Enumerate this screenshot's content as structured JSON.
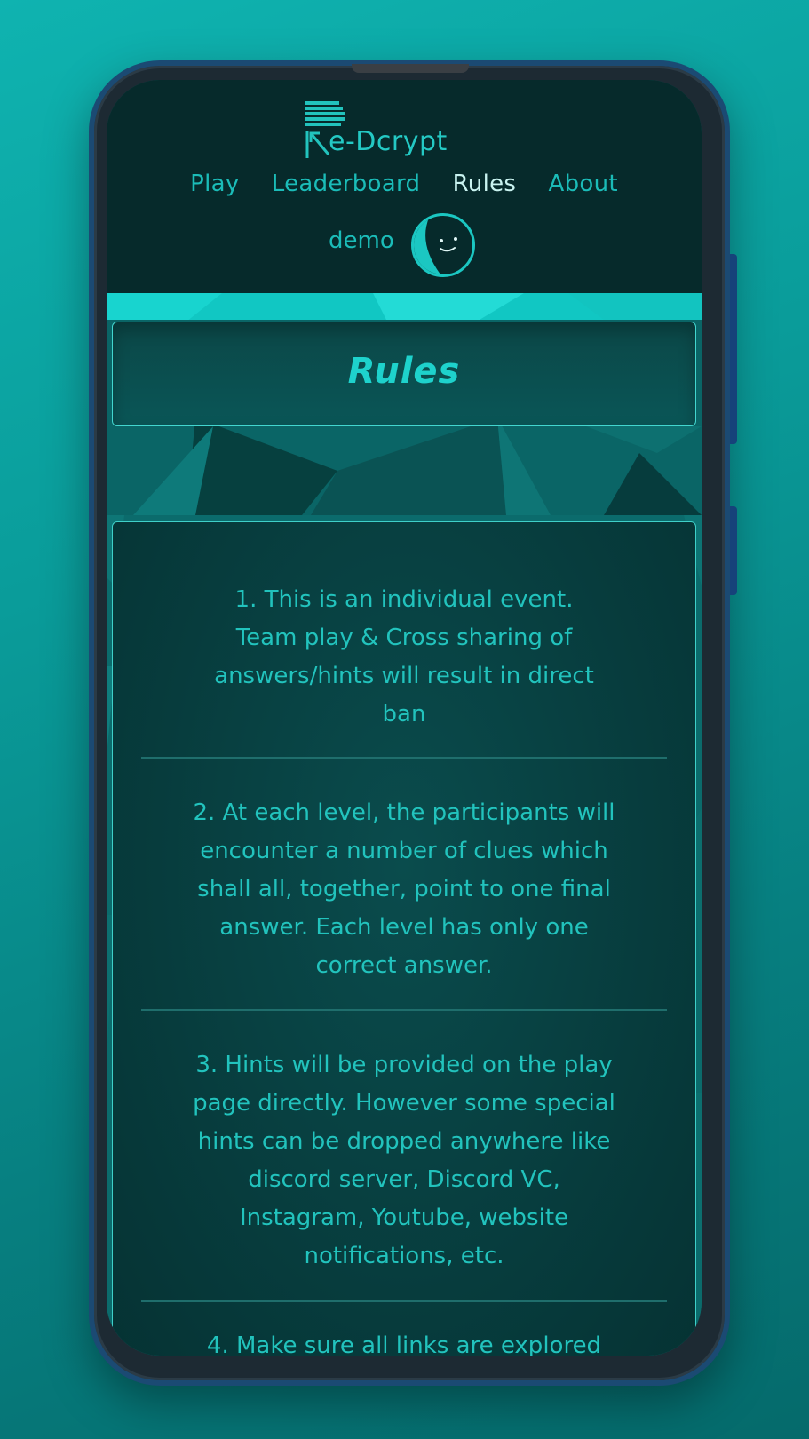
{
  "header": {
    "logo_text": "e-Dcrypt",
    "nav": [
      {
        "label": "Play",
        "active": false
      },
      {
        "label": "Leaderboard",
        "active": false
      },
      {
        "label": "Rules",
        "active": true
      },
      {
        "label": "About",
        "active": false
      }
    ],
    "username": "demo"
  },
  "page": {
    "title": "Rules"
  },
  "rules": [
    {
      "lines": [
        "1. This is an individual event.",
        "Team play & Cross sharing of",
        "answers/hints will result in direct",
        "ban"
      ]
    },
    {
      "lines": [
        "2. At each level, the participants will",
        "encounter a number of clues which",
        "shall all, together, point to one final",
        "answer. Each level has only one",
        "correct answer."
      ]
    },
    {
      "lines": [
        "3. Hints will be provided on the play",
        "page directly. However some special",
        "hints can be dropped anywhere like",
        "discord server, Discord VC,",
        "Instagram, Youtube, website",
        "notifications, etc."
      ]
    },
    {
      "lines": [
        "4. Make sure all links are explored"
      ]
    }
  ],
  "colors": {
    "accent": "#1bbcb8",
    "active_nav": "#c9f3f0",
    "header_bg": "#062a2b",
    "background": "#0a9c9a",
    "phone_frame": "#1b4a73"
  },
  "icons": {
    "avatar": "smiley-face-avatar-icon",
    "logo": "re-dcrypt-logo-icon"
  }
}
